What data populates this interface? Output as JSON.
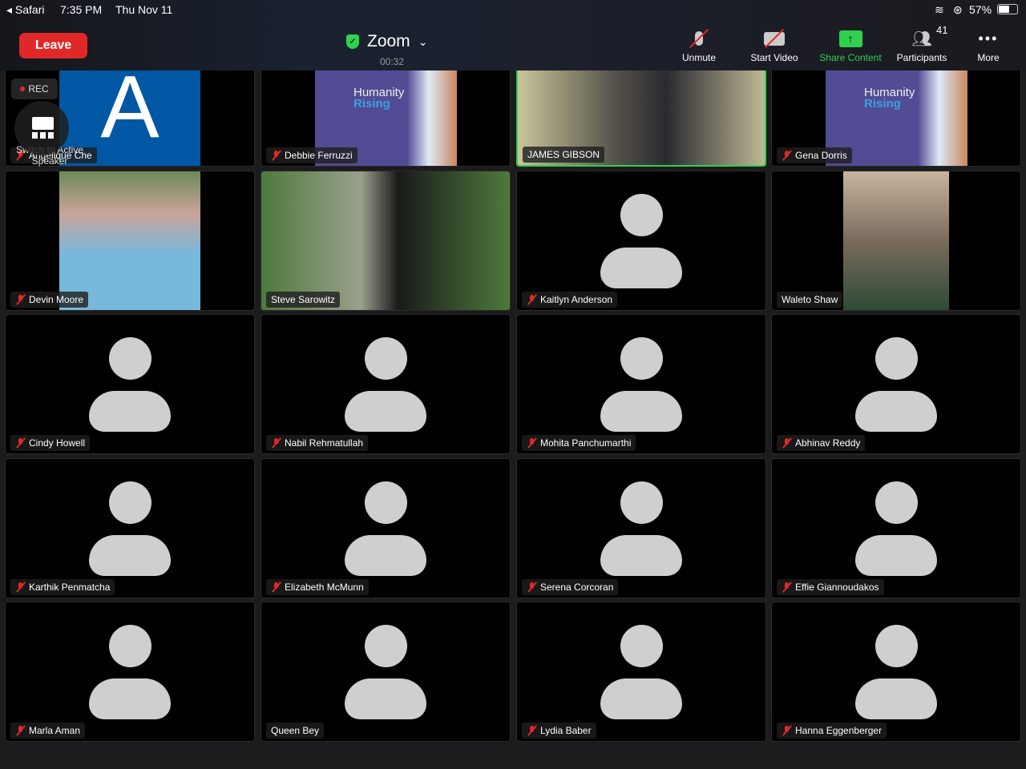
{
  "status_bar": {
    "back_app": "Safari",
    "time": "7:35 PM",
    "date": "Thu Nov 11",
    "battery": "57%"
  },
  "header": {
    "leave_label": "Leave",
    "title": "Zoom",
    "elapsed": "00:32"
  },
  "toolbar": {
    "unmute": "Unmute",
    "start_video": "Start Video",
    "share_content": "Share Content",
    "participants": "Participants",
    "participant_count": "41",
    "more": "More"
  },
  "overlay": {
    "rec": "REC",
    "switch_view": "Switch to Active Speaker"
  },
  "colors": {
    "leave": "#e02828",
    "share": "#2fd14f",
    "muted": "#e02828",
    "active_speaker": "#2fd14f"
  },
  "participants": [
    {
      "name": "Angelique Che",
      "muted": true,
      "kind": "letter",
      "letter": "A"
    },
    {
      "name": "Debbie Ferruzzi",
      "muted": true,
      "kind": "logo",
      "logo": [
        "Humanity",
        "Rising"
      ]
    },
    {
      "name": "JAMES GIBSON",
      "muted": false,
      "kind": "video",
      "active": true
    },
    {
      "name": "Gena Dorris",
      "muted": true,
      "kind": "logo",
      "logo": [
        "Humanity",
        "Rising"
      ]
    },
    {
      "name": "Devin Moore",
      "muted": true,
      "kind": "video-narrow"
    },
    {
      "name": "Steve Sarowitz",
      "muted": false,
      "kind": "video-garden"
    },
    {
      "name": "Kaitlyn Anderson",
      "muted": true,
      "kind": "avatar"
    },
    {
      "name": "Waleto Shaw",
      "muted": false,
      "kind": "video-portrait"
    },
    {
      "name": "Cindy Howell",
      "muted": true,
      "kind": "avatar"
    },
    {
      "name": "Nabil Rehmatullah",
      "muted": true,
      "kind": "avatar"
    },
    {
      "name": "Mohita Panchumarthi",
      "muted": true,
      "kind": "avatar"
    },
    {
      "name": "Abhinav Reddy",
      "muted": true,
      "kind": "avatar"
    },
    {
      "name": "Karthik Penmatcha",
      "muted": true,
      "kind": "avatar"
    },
    {
      "name": "Elizabeth McMunn",
      "muted": true,
      "kind": "avatar"
    },
    {
      "name": "Serena Corcoran",
      "muted": true,
      "kind": "avatar"
    },
    {
      "name": "Effie Giannoudakos",
      "muted": true,
      "kind": "avatar"
    },
    {
      "name": "Marla Aman",
      "muted": true,
      "kind": "avatar"
    },
    {
      "name": "Queen Bey",
      "muted": false,
      "kind": "avatar"
    },
    {
      "name": "Lydia Baber",
      "muted": true,
      "kind": "avatar"
    },
    {
      "name": "Hanna Eggenberger",
      "muted": true,
      "kind": "avatar"
    }
  ]
}
